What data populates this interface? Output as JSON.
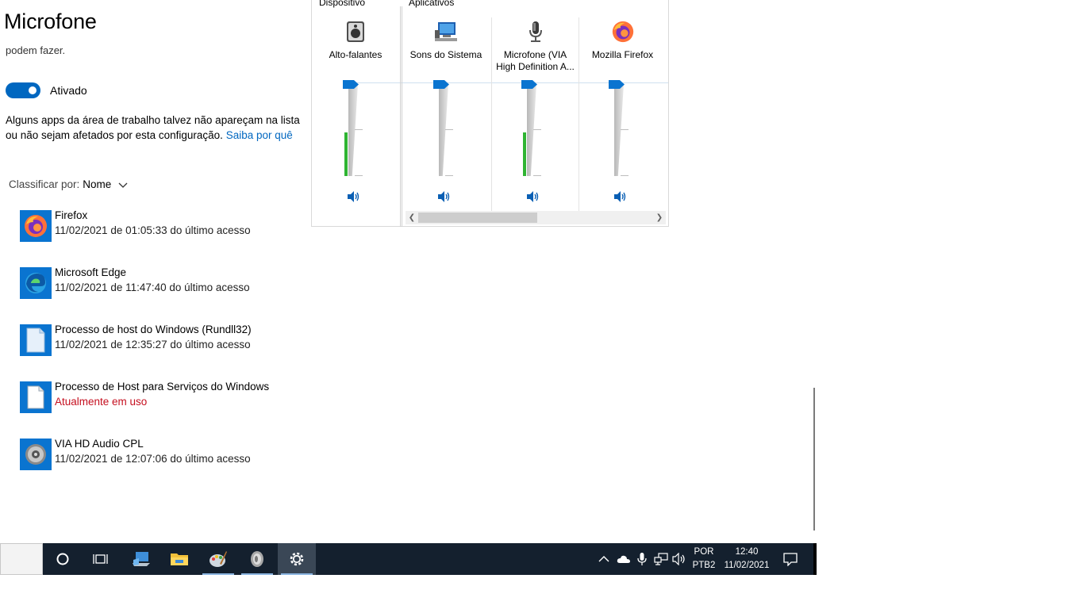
{
  "page": {
    "title": "Microfone",
    "partial_text": "podem fazer.",
    "toggle": {
      "label": "Ativado",
      "state": "on"
    },
    "info": {
      "text": "Alguns apps da área de trabalho talvez não apareçam na lista ou não sejam afetados por esta configuração.",
      "link": "Saiba por quê"
    },
    "sort": {
      "label": "Classificar por:",
      "value": "Nome"
    },
    "apps": [
      {
        "name": "Firefox",
        "status": "11/02/2021 de 01:05:33 do último acesso",
        "icon": "firefox-icon",
        "in_use": false
      },
      {
        "name": "Microsoft Edge",
        "status": "11/02/2021 de 11:47:40 do último acesso",
        "icon": "edge-icon",
        "in_use": false
      },
      {
        "name": "Processo de host do Windows (Rundll32)",
        "status": "11/02/2021 de 12:35:27 do último acesso",
        "icon": "document-icon",
        "in_use": false
      },
      {
        "name": "Processo de Host para Serviços do Windows",
        "status": "Atualmente em uso",
        "icon": "document-icon",
        "in_use": true
      },
      {
        "name": "VIA HD Audio CPL",
        "status": "11/02/2021 de 12:07:06 do último acesso",
        "icon": "speaker-disc-icon",
        "in_use": false
      }
    ],
    "in_use_color": "#c50f1f",
    "link_color": "#0067c0"
  },
  "mixer": {
    "group_device": "Dispositivo",
    "group_apps": "Aplicativos",
    "channels": [
      {
        "label": "Alto-falantes",
        "icon": "speaker-icon",
        "volume": 1.0,
        "peak": 0.47
      },
      {
        "label": "Sons do Sistema",
        "icon": "system-sounds-icon",
        "volume": 1.0,
        "peak": 0.0
      },
      {
        "label": "Microfone (VIA High Definition A...",
        "icon": "microphone-icon",
        "volume": 1.0,
        "peak": 0.47
      },
      {
        "label": "Mozilla Firefox",
        "icon": "firefox-icon",
        "volume": 1.0,
        "peak": 0.0
      }
    ]
  },
  "taskbar": {
    "apps": [
      {
        "name": "cortana-icon"
      },
      {
        "name": "task-view-icon"
      },
      {
        "name": "laptop-app-icon"
      },
      {
        "name": "file-explorer-icon"
      },
      {
        "name": "paint-icon"
      },
      {
        "name": "via-audio-icon"
      },
      {
        "name": "settings-gear-icon"
      }
    ],
    "tray": {
      "language_line1": "POR",
      "language_line2": "PTB2",
      "time": "12:40",
      "date": "11/02/2021"
    }
  }
}
